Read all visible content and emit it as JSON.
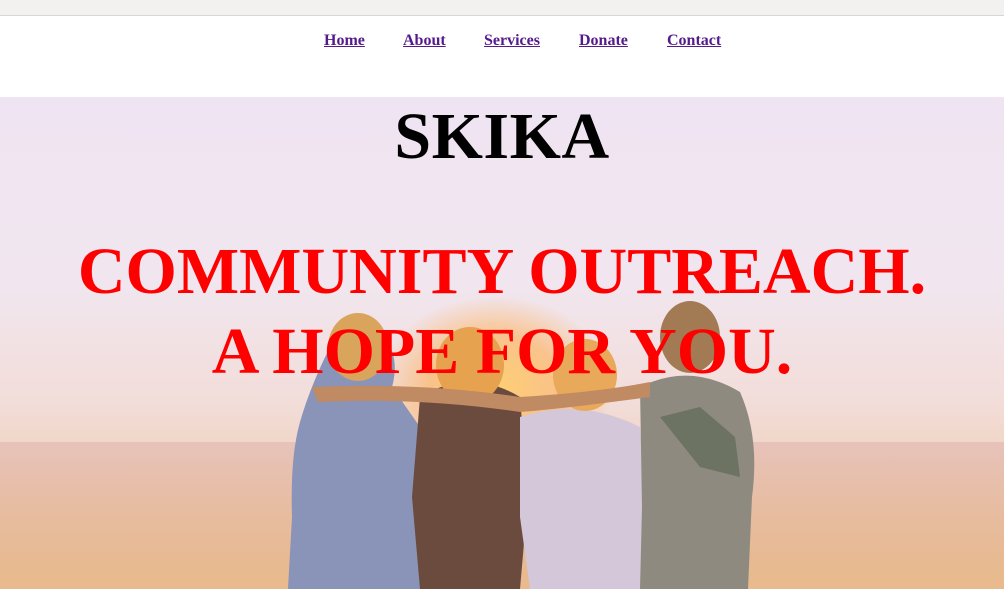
{
  "nav": {
    "items": [
      {
        "label": "Home"
      },
      {
        "label": "About"
      },
      {
        "label": "Services"
      },
      {
        "label": "Donate"
      },
      {
        "label": "Contact"
      }
    ]
  },
  "hero": {
    "title": "SKIKA",
    "tagline_line1": "COMMUNITY OUTREACH.",
    "tagline_line2": "A HOPE FOR YOU.",
    "image_description_icon": "group-hug-photo"
  },
  "colors": {
    "link": "#551a8b",
    "title": "#000000",
    "tagline": "#ff0000",
    "topbar": "#f2f1ef"
  }
}
